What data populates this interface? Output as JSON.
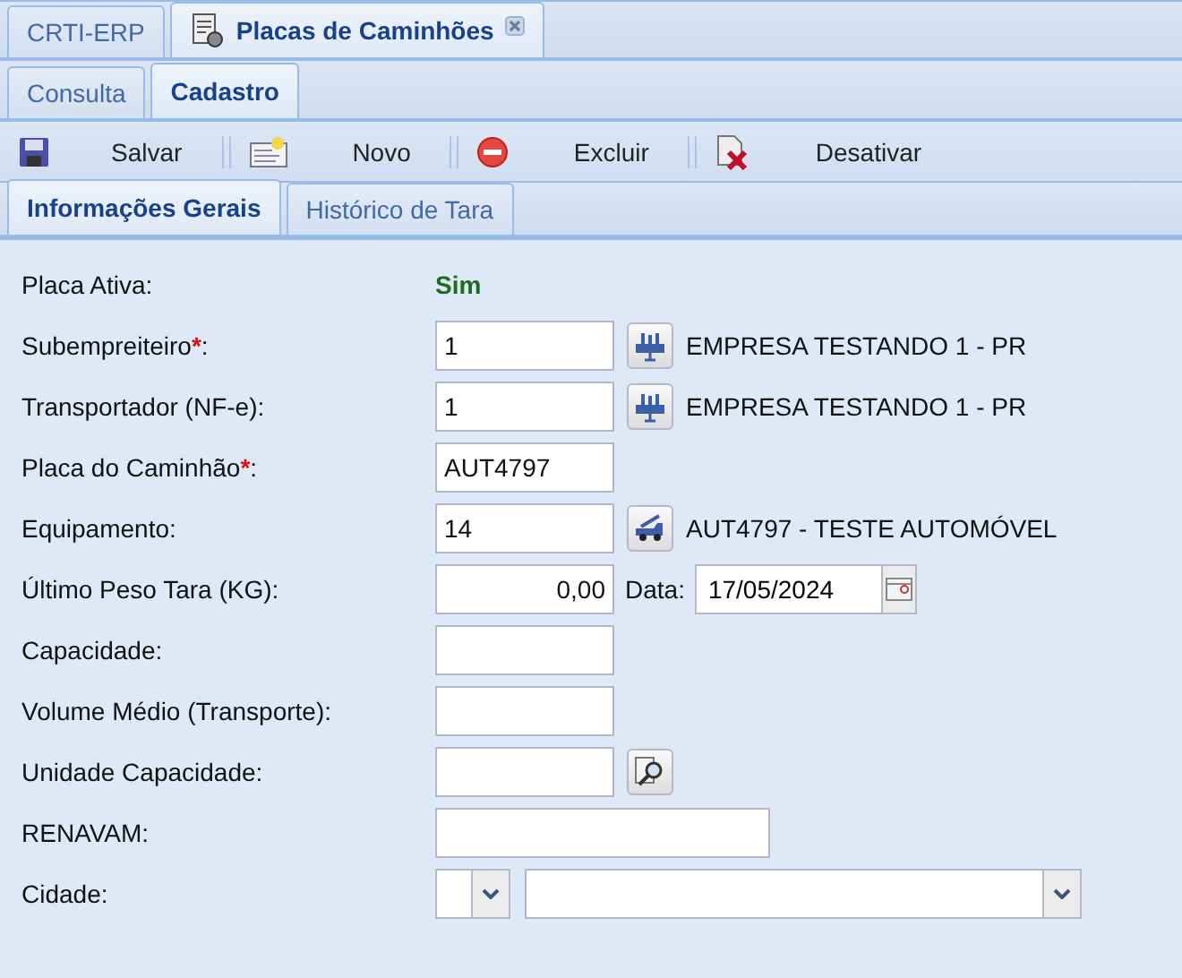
{
  "window_tabs": [
    {
      "label": "CRTI-ERP",
      "selected": false,
      "closable": false
    },
    {
      "label": "Placas de Caminhões",
      "selected": true,
      "closable": true
    }
  ],
  "sub_tabs": [
    {
      "label": "Consulta",
      "selected": false
    },
    {
      "label": "Cadastro",
      "selected": true
    }
  ],
  "toolbar": [
    {
      "label": "Salvar",
      "kind": "save"
    },
    {
      "label": "Novo",
      "kind": "new"
    },
    {
      "label": "Excluir",
      "kind": "delete"
    },
    {
      "label": "Desativar",
      "kind": "deactivate"
    }
  ],
  "form_tabs": [
    {
      "label": "Informações Gerais",
      "selected": true
    },
    {
      "label": "Histórico de Tara",
      "selected": false
    }
  ],
  "form": [
    {
      "label": "Placa Ativa:",
      "kind": "status",
      "value": "Sim"
    },
    {
      "label": "Subempreiteiro",
      "required_mark": "*",
      "suffix": ":",
      "kind": "company-lookup",
      "value": "1",
      "description": "EMPRESA TESTANDO 1 - PR"
    },
    {
      "label": "Transportador (NF-e):",
      "kind": "company-lookup",
      "value": "1",
      "description": "EMPRESA TESTANDO 1 - PR"
    },
    {
      "label": "Placa do Caminhão",
      "required_mark": "*",
      "suffix": ":",
      "kind": "text",
      "value": "AUT4797"
    },
    {
      "label": "Equipamento:",
      "kind": "vehicle-lookup",
      "value": "14",
      "description": "AUT4797 - TESTE AUTOMÓVEL"
    },
    {
      "label": "Último Peso Tara (KG):",
      "kind": "weight-date",
      "value": "0,00",
      "date_label": "Data:",
      "date": "17/05/2024"
    },
    {
      "label": "Capacidade:",
      "kind": "text"
    },
    {
      "label": "Volume Médio (Transporte):",
      "kind": "text"
    },
    {
      "label": "Unidade Capacidade:",
      "kind": "search-text"
    },
    {
      "label": "RENAVAM:",
      "kind": "wide-text"
    },
    {
      "label": "Cidade:",
      "kind": "combo-pair"
    }
  ]
}
